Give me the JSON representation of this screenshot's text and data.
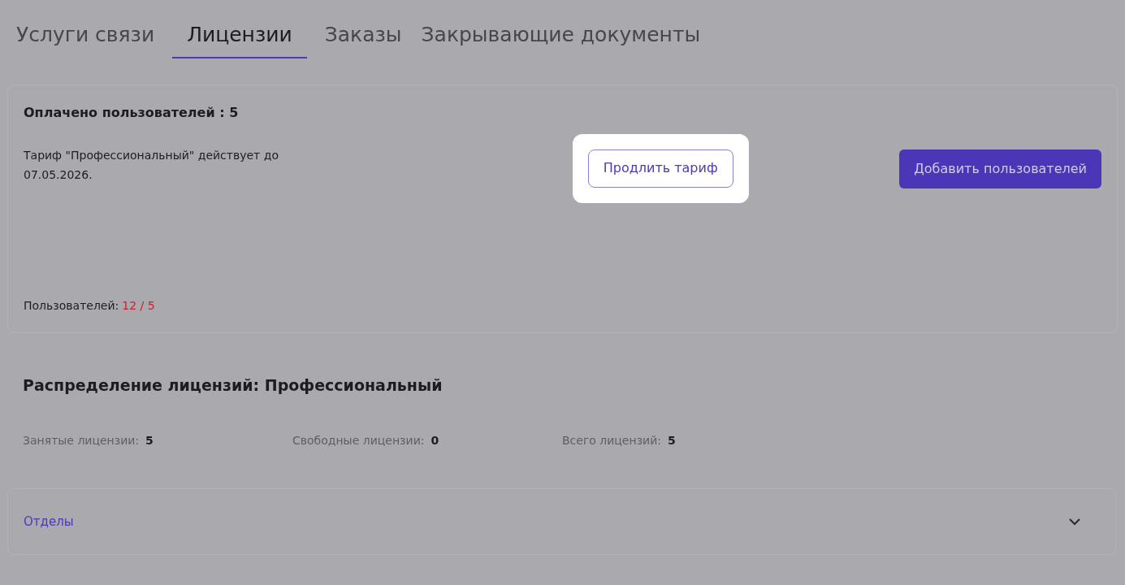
{
  "tabs": [
    {
      "label": "Услуги связи",
      "selected": false
    },
    {
      "label": "Лицензии",
      "selected": true
    },
    {
      "label": "Заказы",
      "selected": false
    },
    {
      "label": "Закрывающие документы",
      "selected": false
    }
  ],
  "license_card": {
    "title": "Оплачено пользователей : 5",
    "description": "Тариф \"Профессиональный\" действует до 07.05.2026.",
    "extend_button": {
      "label": "Продлить тариф",
      "highlighted": true
    },
    "add_button": {
      "label": "Добавить пользователей"
    },
    "users_label": "Пользователей:",
    "users_value": "12 / 5"
  },
  "distribution": {
    "title": "Распределение лицензий: Профессиональный",
    "stats": [
      {
        "label": "Занятые лицензии:",
        "value": "5"
      },
      {
        "label": "Свободные лицензии:",
        "value": "0"
      },
      {
        "label": "Всего лицензий:",
        "value": "5"
      }
    ]
  },
  "accordion": {
    "label": "Отделы",
    "expanded": false
  }
}
